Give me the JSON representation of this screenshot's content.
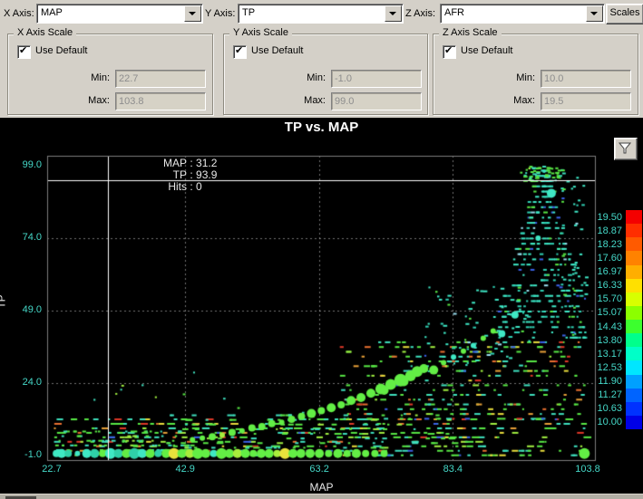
{
  "toolbar": {
    "x_label": "X Axis:",
    "x_value": "MAP",
    "y_label": "Y Axis:",
    "y_value": "TP",
    "z_label": "Z Axis:",
    "z_value": "AFR",
    "scales_label": "Scales"
  },
  "scales": {
    "use_default_label": "Use Default",
    "min_label": "Min:",
    "max_label": "Max:",
    "x": {
      "title": "X Axis Scale",
      "min": "22.7",
      "max": "103.8",
      "use_default": true
    },
    "y": {
      "title": "Y Axis Scale",
      "min": "-1.0",
      "max": "99.0",
      "use_default": true
    },
    "z": {
      "title": "Z Axis Scale",
      "min": "10.0",
      "max": "19.5",
      "use_default": true
    }
  },
  "readout": {
    "lines": [
      {
        "label": "MAP",
        "value": "31.2"
      },
      {
        "label": "TP",
        "value": "93.9"
      },
      {
        "label": "Hits",
        "value": "0"
      }
    ]
  },
  "chart_data": {
    "type": "scatter",
    "title": "TP vs. MAP",
    "xlabel": "MAP",
    "ylabel": "TP",
    "x_range": [
      22.7,
      103.8
    ],
    "y_range": [
      -1.0,
      99.0
    ],
    "x_ticks": [
      "22.7",
      "42.9",
      "63.2",
      "83.4",
      "103.8"
    ],
    "y_ticks": [
      "99.0",
      "74.0",
      "49.0",
      "24.0",
      "-1.0"
    ],
    "grid": true,
    "crosshair": {
      "map": 31.2,
      "tp": 93.9,
      "hits": 0
    },
    "colorbar": {
      "min": 10.0,
      "max": 19.5,
      "labels": [
        "19.50",
        "18.87",
        "18.23",
        "17.60",
        "16.97",
        "16.33",
        "15.70",
        "15.07",
        "14.43",
        "13.80",
        "13.17",
        "12.53",
        "11.90",
        "11.27",
        "10.63",
        "10.00"
      ],
      "colors": [
        "#f40000",
        "#ff2e00",
        "#ff5a00",
        "#ff8200",
        "#ffae00",
        "#ffe000",
        "#d8ff00",
        "#8cff00",
        "#3cff2e",
        "#00ff8c",
        "#00ffc8",
        "#00e6ff",
        "#00a0ff",
        "#0064ff",
        "#0032ff",
        "#0000e6"
      ]
    },
    "palette": {
      "g": "#63ee45",
      "yg": "#a8ee3c",
      "y": "#e8e23c",
      "c": "#3fe8c4",
      "t": "#2fd0a8"
    },
    "blobs": [
      [
        23.4,
        -0.3,
        4,
        "c"
      ],
      [
        24.2,
        -0.3,
        5,
        "c"
      ],
      [
        25.2,
        -0.3,
        4,
        "t"
      ],
      [
        26.6,
        -0.3,
        3,
        "c"
      ],
      [
        28.0,
        -0.3,
        5,
        "c"
      ],
      [
        29.2,
        -0.3,
        5,
        "t"
      ],
      [
        30.4,
        -0.3,
        4,
        "g"
      ],
      [
        31.6,
        -0.3,
        6,
        "c"
      ],
      [
        32.8,
        -0.3,
        5,
        "t"
      ],
      [
        34.0,
        -0.3,
        5,
        "g"
      ],
      [
        35.2,
        -0.3,
        6,
        "t"
      ],
      [
        36.4,
        -0.3,
        5,
        "c"
      ],
      [
        37.6,
        -0.3,
        5,
        "g"
      ],
      [
        38.8,
        -0.3,
        4,
        "t"
      ],
      [
        40.0,
        -0.3,
        5,
        "g"
      ],
      [
        41.2,
        -0.3,
        6,
        "y"
      ],
      [
        42.4,
        -0.3,
        5,
        "g"
      ],
      [
        43.6,
        -0.3,
        5,
        "yg"
      ],
      [
        44.8,
        -0.3,
        6,
        "g"
      ],
      [
        46.0,
        -0.3,
        5,
        "g"
      ],
      [
        47.2,
        -0.3,
        4,
        "c"
      ],
      [
        48.4,
        -0.3,
        6,
        "g"
      ],
      [
        49.6,
        -0.3,
        5,
        "g"
      ],
      [
        50.8,
        -0.3,
        5,
        "yg"
      ],
      [
        52.0,
        -0.3,
        5,
        "g"
      ],
      [
        53.2,
        -0.3,
        4,
        "g"
      ],
      [
        54.4,
        -0.3,
        5,
        "g"
      ],
      [
        55.6,
        -0.3,
        5,
        "g"
      ],
      [
        56.8,
        -0.3,
        4,
        "yg"
      ],
      [
        58.0,
        -0.3,
        6,
        "y"
      ],
      [
        59.2,
        -0.3,
        5,
        "g"
      ],
      [
        60.4,
        -0.3,
        5,
        "g"
      ],
      [
        61.8,
        -0.3,
        5,
        "g"
      ],
      [
        63.2,
        -0.3,
        5,
        "g"
      ],
      [
        64.6,
        -0.3,
        4,
        "g"
      ],
      [
        66.0,
        -0.3,
        5,
        "g"
      ],
      [
        67.4,
        -0.3,
        4,
        "g"
      ],
      [
        68.8,
        -0.3,
        5,
        "g"
      ],
      [
        70.2,
        -0.3,
        4,
        "g"
      ],
      [
        71.6,
        -0.3,
        4,
        "g"
      ],
      [
        73.0,
        -0.3,
        4,
        "g"
      ],
      [
        103.3,
        -0.3,
        6,
        "g"
      ],
      [
        44.0,
        4.5,
        3,
        "g"
      ],
      [
        45.5,
        5.0,
        3,
        "g"
      ],
      [
        47.0,
        5.5,
        4,
        "g"
      ],
      [
        48.5,
        6.0,
        3,
        "yg"
      ],
      [
        50.0,
        7.0,
        4,
        "g"
      ],
      [
        51.5,
        7.5,
        3,
        "g"
      ],
      [
        53.0,
        8.5,
        4,
        "g"
      ],
      [
        54.5,
        9.0,
        4,
        "g"
      ],
      [
        56.0,
        10.0,
        4,
        "g"
      ],
      [
        57.5,
        10.5,
        3,
        "g"
      ],
      [
        59.0,
        11.5,
        4,
        "g"
      ],
      [
        60.5,
        12.5,
        4,
        "g"
      ],
      [
        62.0,
        13.5,
        5,
        "g"
      ],
      [
        63.5,
        14.5,
        4,
        "g"
      ],
      [
        65.0,
        15.5,
        5,
        "g"
      ],
      [
        66.5,
        16.5,
        4,
        "g"
      ],
      [
        68.0,
        18.0,
        5,
        "g"
      ],
      [
        69.5,
        19.0,
        5,
        "g"
      ],
      [
        71.0,
        20.5,
        5,
        "g"
      ],
      [
        72.5,
        22.0,
        6,
        "g"
      ],
      [
        74.0,
        23.5,
        6,
        "g"
      ],
      [
        75.5,
        25.0,
        7,
        "g"
      ],
      [
        77.0,
        26.5,
        6,
        "g"
      ],
      [
        78.0,
        28.0,
        6,
        "g"
      ],
      [
        79.0,
        29.0,
        5,
        "g"
      ],
      [
        80.5,
        28.5,
        5,
        "g"
      ],
      [
        76.0,
        24.5,
        5,
        "g"
      ],
      [
        73.0,
        21.5,
        5,
        "g"
      ],
      [
        82.0,
        31.0,
        3,
        "g"
      ],
      [
        83.5,
        33.0,
        3,
        "c"
      ],
      [
        85.0,
        35.0,
        3,
        "g"
      ],
      [
        86.5,
        37.0,
        3,
        "c"
      ],
      [
        88.0,
        39.5,
        3,
        "g"
      ],
      [
        89.5,
        42.0,
        3,
        "g"
      ],
      [
        98.3,
        89.5,
        5,
        "c"
      ],
      [
        92.8,
        47.5,
        4,
        "c"
      ],
      [
        90.8,
        41.0,
        4,
        "c"
      ],
      [
        96.3,
        74.0,
        3,
        "c"
      ]
    ],
    "noise_palettes": {
      "mixed": [
        [
          "#58e845",
          38
        ],
        [
          "#3ee0be",
          26
        ],
        [
          "#a0ee40",
          8
        ],
        [
          "#e8dc3c",
          6
        ],
        [
          "#e87030",
          8
        ],
        [
          "#e03828",
          6
        ],
        [
          "#3b62e8",
          4
        ],
        [
          "#e8a038",
          4
        ]
      ],
      "cyan": [
        [
          "#3ee8c6",
          55
        ],
        [
          "#2fd0b4",
          25
        ],
        [
          "#58e845",
          12
        ],
        [
          "#3b62e8",
          4
        ],
        [
          "#9adff0",
          4
        ]
      ],
      "greencyan": [
        [
          "#58e845",
          50
        ],
        [
          "#3ee0be",
          35
        ],
        [
          "#a0ee40",
          15
        ]
      ]
    },
    "noise_regions": [
      {
        "seed": 7,
        "count": 380,
        "map": [
          23,
          103.2
        ],
        "rows": {
          "base": -0.6,
          "step": 1.55,
          "n": 9
        },
        "w": [
          2,
          9
        ],
        "colors": "mixed"
      },
      {
        "seed": 11,
        "count": 130,
        "map": [
          40,
          84
        ],
        "rows": {
          "base": 2.0,
          "step": 1.6,
          "n": 8
        },
        "w": [
          2,
          8
        ],
        "colors": "greencyan"
      },
      {
        "seed": 13,
        "count": 280,
        "map": [
          66,
          103.4
        ],
        "rows": {
          "base": 12.0,
          "step": 1.65,
          "n": 17
        },
        "w": [
          2,
          7
        ],
        "colors": "mixed"
      },
      {
        "seed": 17,
        "count": 300,
        "funnel": {
          "center": 96.8,
          "half0": 0.6,
          "k": 0.125,
          "step": 1.8
        },
        "tp": [
          40,
          99
        ],
        "w": [
          2,
          5
        ],
        "colors": "cyan"
      },
      {
        "seed": 19,
        "count": 55,
        "map": [
          99.5,
          103.5
        ],
        "tp": [
          40,
          96
        ],
        "w": [
          2,
          4
        ],
        "colors": "cyan"
      },
      {
        "seed": 23,
        "count": 90,
        "map": [
          23,
          44
        ],
        "rows": {
          "base": 1.2,
          "step": 1.6,
          "n": 5
        },
        "w": [
          2,
          5
        ],
        "colors": "greencyan"
      },
      {
        "seed": 29,
        "count": 60,
        "map": [
          93.5,
          100
        ],
        "tp": [
          93.8,
          99
        ],
        "w": [
          2,
          5
        ],
        "colors": "greencyan"
      },
      {
        "seed": 31,
        "count": 80,
        "map": [
          79,
          95
        ],
        "tp": [
          28,
          58
        ],
        "w": [
          2,
          5
        ],
        "colors": "cyan"
      },
      {
        "seed": 37,
        "count": 12,
        "map": [
          25,
          62
        ],
        "tp": [
          10,
          28
        ],
        "w": [
          2,
          3
        ],
        "colors": "greencyan"
      }
    ]
  }
}
